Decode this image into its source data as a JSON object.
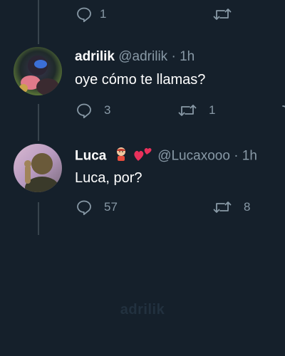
{
  "top_tweet": {
    "reply_count": "1"
  },
  "tweets": [
    {
      "name": "adrilik",
      "handle": "@adrilik",
      "separator": "·",
      "time": "1h",
      "text": "oye cómo te llamas?",
      "reply_count": "3",
      "retweet_count": "1"
    },
    {
      "name": "Luca",
      "handle": "@Lucaxooo",
      "separator": "·",
      "time": "1h",
      "text": "Luca, por?",
      "reply_count": "57",
      "retweet_count": "8"
    }
  ],
  "watermark": "adrilik",
  "colors": {
    "background": "#15202b",
    "secondary_text": "#8899a6",
    "thread_line": "#38444d"
  },
  "icons": [
    "reply-icon",
    "retweet-icon",
    "face-emoji-icon",
    "hearts-emoji-icon"
  ]
}
